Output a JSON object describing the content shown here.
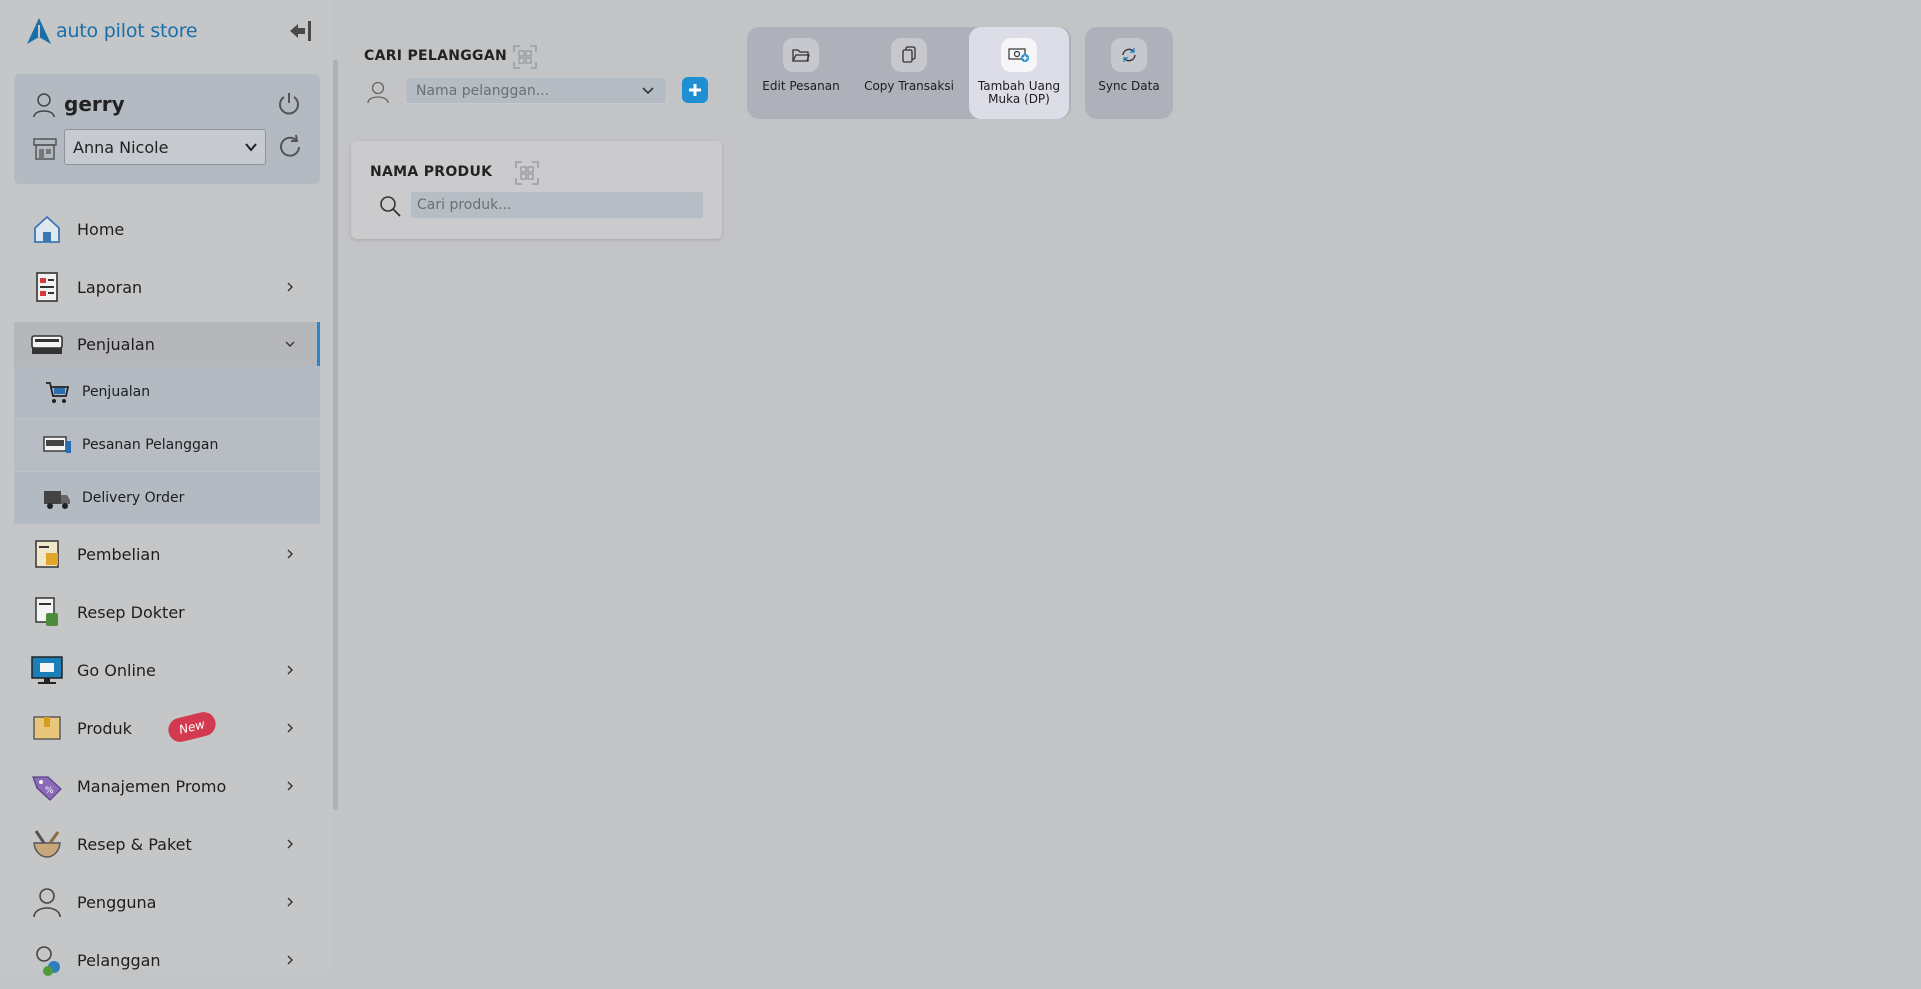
{
  "app": {
    "logo_text": "auto pilot store"
  },
  "user": {
    "name": "gerry",
    "store_selected": "Anna Nicole"
  },
  "menu": {
    "home": "Home",
    "laporan": "Laporan",
    "penjualan": "Penjualan",
    "penjualan_sub": [
      "Penjualan",
      "Pesanan Pelanggan",
      "Delivery Order"
    ],
    "pembelian": "Pembelian",
    "resep_dokter": "Resep Dokter",
    "go_online": "Go Online",
    "produk": "Produk",
    "produk_badge": "New",
    "manajemen_promo": "Manajemen Promo",
    "resep_paket": "Resep & Paket",
    "pengguna": "Pengguna",
    "pelanggan": "Pelanggan"
  },
  "customer": {
    "title": "CARI PELANGGAN",
    "placeholder": "Nama pelanggan..."
  },
  "actions": {
    "edit_pesanan": "Edit Pesanan",
    "copy_transaksi": "Copy Transaksi",
    "tambah_dp": "Tambah Uang Muka (DP)",
    "sync_data": "Sync Data"
  },
  "product": {
    "title": "NAMA PRODUK",
    "placeholder": "Cari produk..."
  },
  "colors": {
    "accent": "#1f8fd1",
    "badge": "#d33a50",
    "sidebar_active_border": "#2a86c8"
  }
}
